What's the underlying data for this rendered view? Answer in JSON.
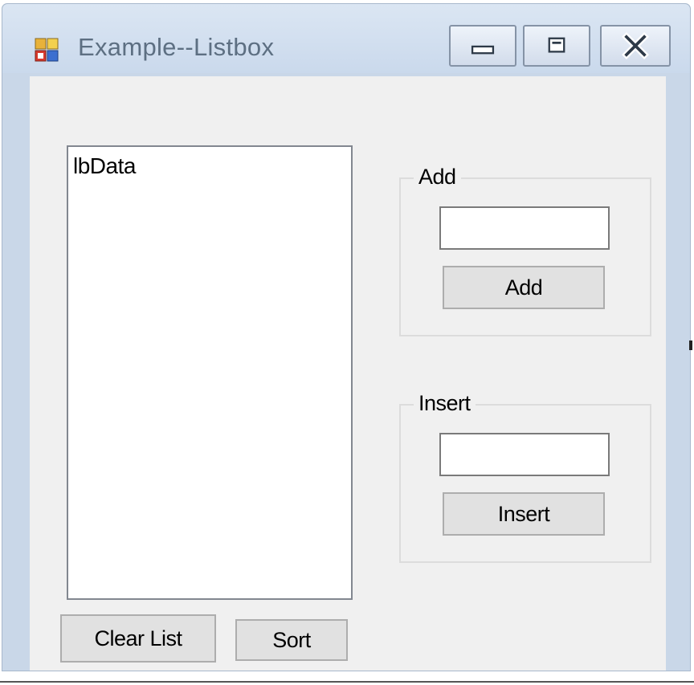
{
  "window": {
    "title": "Example--Listbox",
    "icon": "app-window-icon",
    "controls": [
      "minimize-icon",
      "maximize-icon",
      "close-icon"
    ]
  },
  "listbox": {
    "items": [
      "lbData"
    ]
  },
  "add_group": {
    "title": "Add",
    "input_value": "",
    "button_label": "Add"
  },
  "insert_group": {
    "title": "Insert",
    "input_value": "",
    "button_label": "Insert"
  },
  "bottom_buttons": {
    "clear_label": "Clear List",
    "sort_label": "Sort"
  },
  "colors": {
    "titlebar": "#cad9ec",
    "client": "#f0f0f0",
    "button": "#e1e1e1"
  }
}
